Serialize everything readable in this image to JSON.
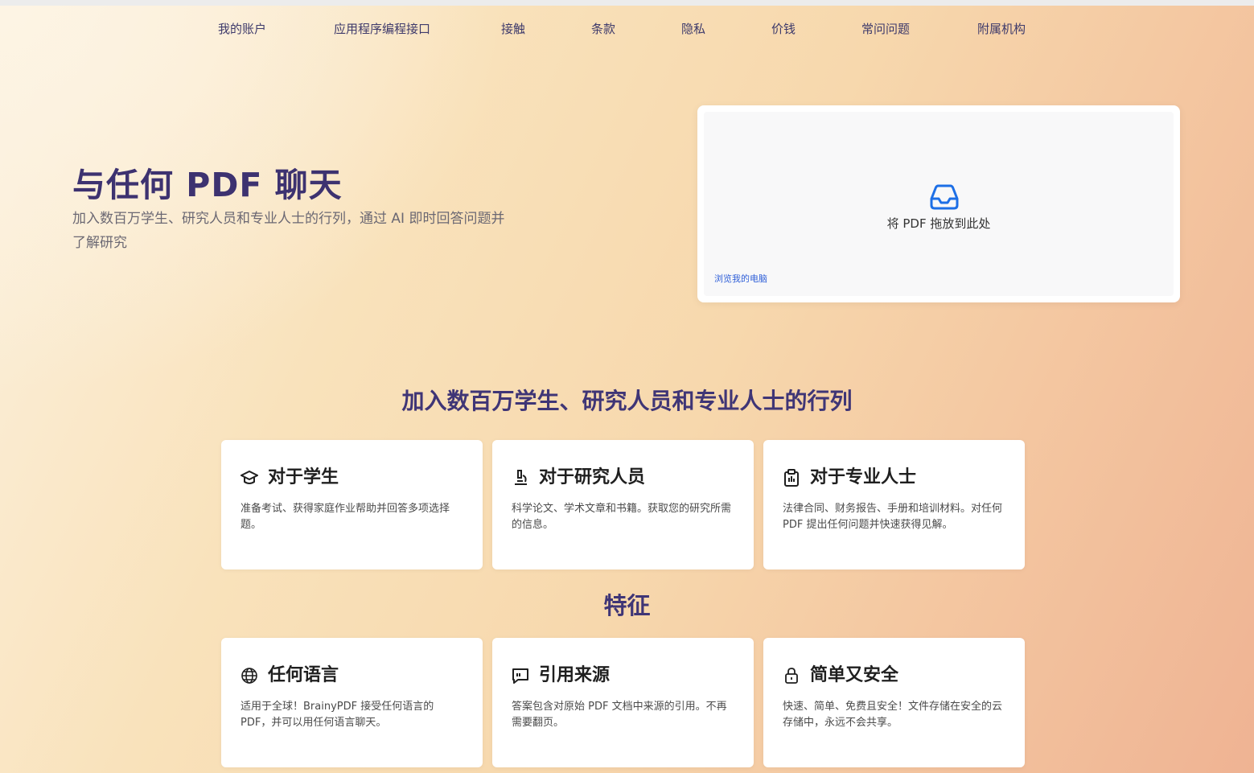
{
  "nav": {
    "items": [
      {
        "label": "我的账户"
      },
      {
        "label": "应用程序编程接口"
      },
      {
        "label": "接触"
      },
      {
        "label": "条款"
      },
      {
        "label": "隐私"
      },
      {
        "label": "价钱"
      },
      {
        "label": "常问问题"
      },
      {
        "label": "附属机构"
      }
    ]
  },
  "hero": {
    "title": "与任何 PDF 聊天",
    "subtitle": "加入数百万学生、研究人员和专业人士的行列，通过 AI 即时回答问题并了解研究"
  },
  "upload": {
    "icon": "inbox-icon",
    "drop_text": "将 PDF 拖放到此处",
    "browse_text": "浏览我的电脑"
  },
  "audience": {
    "heading": "加入数百万学生、研究人员和专业人士的行列",
    "cards": [
      {
        "icon": "graduation-cap-icon",
        "title": "对于学生",
        "desc": "准备考试、获得家庭作业帮助并回答多项选择题。"
      },
      {
        "icon": "microscope-icon",
        "title": "对于研究人员",
        "desc": "科学论文、学术文章和书籍。获取您的研究所需的信息。"
      },
      {
        "icon": "clipboard-icon",
        "title": "对于专业人士",
        "desc": "法律合同、财务报告、手册和培训材料。对任何 PDF 提出任何问题并快速获得见解。"
      }
    ]
  },
  "features": {
    "heading": "特征",
    "cards": [
      {
        "icon": "globe-icon",
        "title": "任何语言",
        "desc": "适用于全球！BrainyPDF 接受任何语言的 PDF，并可以用任何语言聊天。"
      },
      {
        "icon": "quote-icon",
        "title": "引用来源",
        "desc": "答案包含对原始 PDF 文档中来源的引用。不再需要翻页。"
      },
      {
        "icon": "lock-icon",
        "title": "简单又安全",
        "desc": "快速、简单、免费且安全！文件存储在安全的云存储中，永远不会共享。"
      }
    ]
  },
  "colors": {
    "accent": "#3d3270",
    "link": "#2f5fd8",
    "upload_icon": "#1d6fe6"
  }
}
